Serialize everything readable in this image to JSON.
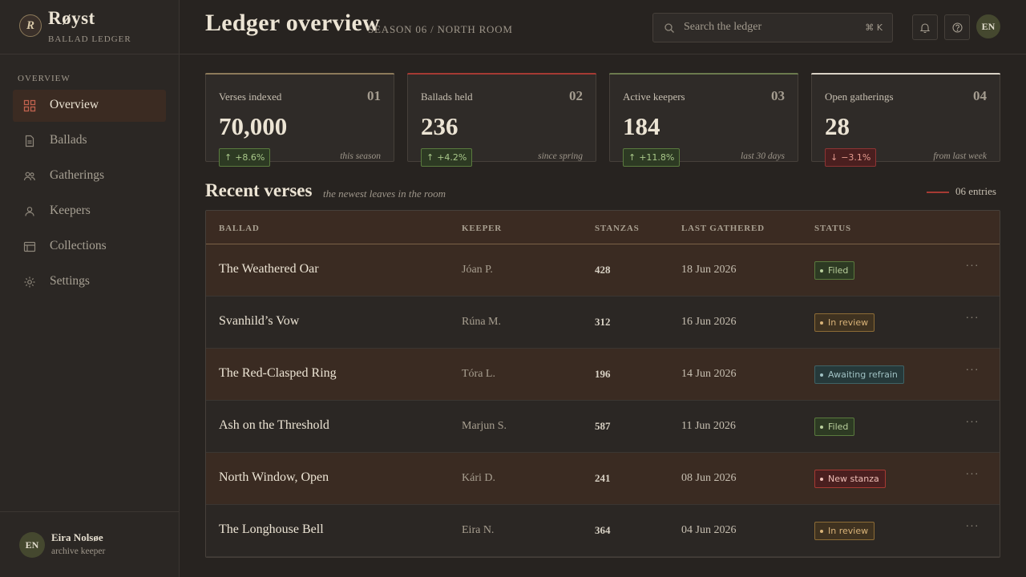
{
  "brand": {
    "name": "Røyst",
    "subtitle": "BALLAD LEDGER",
    "logo_glyph": "R"
  },
  "nav": {
    "section": "OVERVIEW",
    "items": [
      {
        "label": "Overview",
        "icon": "grid-icon",
        "active": true
      },
      {
        "label": "Ballads",
        "icon": "document-icon",
        "active": false
      },
      {
        "label": "Gatherings",
        "icon": "people-icon",
        "active": false
      },
      {
        "label": "Keepers",
        "icon": "person-icon",
        "active": false
      },
      {
        "label": "Collections",
        "icon": "collection-icon",
        "active": false
      },
      {
        "label": "Settings",
        "icon": "gear-icon",
        "active": false
      }
    ]
  },
  "user": {
    "initials": "EN",
    "name": "Eira Nolsøe",
    "role": "archive keeper"
  },
  "header": {
    "title": "Ledger overview",
    "crumb": "SEASON 06 / NORTH ROOM",
    "search_placeholder": "Search the ledger",
    "search_shortcut": "⌘ K",
    "avatar_initials": "EN"
  },
  "stats": [
    {
      "label": "Verses indexed",
      "index": "01",
      "value": "70,000",
      "delta": "+8.6%",
      "direction": "up",
      "period": "this season",
      "accent": "#8c7a5a"
    },
    {
      "label": "Ballads held",
      "index": "02",
      "value": "236",
      "delta": "+4.2%",
      "direction": "up",
      "period": "since spring",
      "accent": "#a63a33"
    },
    {
      "label": "Active keepers",
      "index": "03",
      "value": "184",
      "delta": "+11.8%",
      "direction": "up",
      "period": "last 30 days",
      "accent": "#6b7a4e"
    },
    {
      "label": "Open gatherings",
      "index": "04",
      "value": "28",
      "delta": "−3.1%",
      "direction": "down",
      "period": "from last week",
      "accent": "#d9d2c5"
    }
  ],
  "recent": {
    "title": "Recent verses",
    "subtitle": "the newest leaves in the room",
    "count": "06 entries",
    "columns": [
      "BALLAD",
      "KEEPER",
      "STANZAS",
      "LAST GATHERED",
      "STATUS"
    ],
    "rows": [
      {
        "ballad": "The Weathered Oar",
        "keeper": "Jóan P.",
        "stanzas": "428",
        "date": "18 Jun 2026",
        "status": "Filed",
        "status_kind": "filed"
      },
      {
        "ballad": "Svanhild’s Vow",
        "keeper": "Rúna M.",
        "stanzas": "312",
        "date": "16 Jun 2026",
        "status": "In review",
        "status_kind": "review"
      },
      {
        "ballad": "The Red-Clasped Ring",
        "keeper": "Tóra L.",
        "stanzas": "196",
        "date": "14 Jun 2026",
        "status": "Awaiting refrain",
        "status_kind": "awaiting"
      },
      {
        "ballad": "Ash on the Threshold",
        "keeper": "Marjun S.",
        "stanzas": "587",
        "date": "11 Jun 2026",
        "status": "Filed",
        "status_kind": "filed"
      },
      {
        "ballad": "North Window, Open",
        "keeper": "Kári D.",
        "stanzas": "241",
        "date": "08 Jun 2026",
        "status": "New stanza",
        "status_kind": "newst"
      },
      {
        "ballad": "The Longhouse Bell",
        "keeper": "Eira N.",
        "stanzas": "364",
        "date": "04 Jun 2026",
        "status": "In review",
        "status_kind": "review"
      }
    ]
  }
}
